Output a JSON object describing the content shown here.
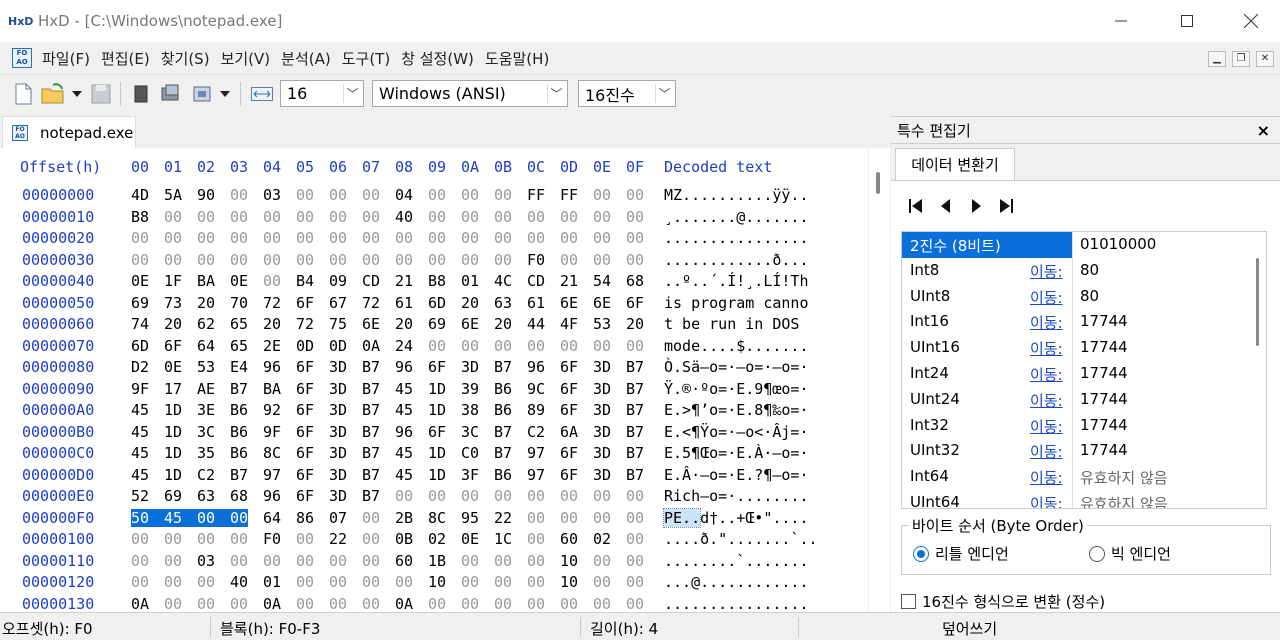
{
  "window": {
    "title": "HxD - [C:\\Windows\\notepad.exe]",
    "logo_text": "HxD",
    "minimize_icon": "minimize-icon",
    "maximize_icon": "maximize-icon",
    "close_icon": "close-icon"
  },
  "menu": {
    "items": [
      "파일(F)",
      "편집(E)",
      "찾기(S)",
      "보기(V)",
      "분석(A)",
      "도구(T)",
      "창 설정(W)",
      "도움말(H)"
    ]
  },
  "toolbar": {
    "bytes_per_row": "16",
    "charset": "Windows (ANSI)",
    "offset_base": "16진수",
    "icons": [
      "new-file-icon",
      "open-file-icon",
      "dropdown-icon",
      "save-icon",
      "copy-icon",
      "disk-icon",
      "process-icon",
      "dropdown-icon",
      "bytes-per-row-icon"
    ]
  },
  "tab": {
    "label": "notepad.exe"
  },
  "hex_view": {
    "offset_header": "Offset(h)",
    "columns": [
      "00",
      "01",
      "02",
      "03",
      "04",
      "05",
      "06",
      "07",
      "08",
      "09",
      "0A",
      "0B",
      "0C",
      "0D",
      "0E",
      "0F"
    ],
    "decoded_header": "Decoded text",
    "rows": [
      {
        "offset": "00000000",
        "bytes": [
          "4D",
          "5A",
          "90",
          "00",
          "03",
          "00",
          "00",
          "00",
          "04",
          "00",
          "00",
          "00",
          "FF",
          "FF",
          "00",
          "00"
        ],
        "text": "MZ..........ÿÿ.."
      },
      {
        "offset": "00000010",
        "bytes": [
          "B8",
          "00",
          "00",
          "00",
          "00",
          "00",
          "00",
          "00",
          "40",
          "00",
          "00",
          "00",
          "00",
          "00",
          "00",
          "00"
        ],
        "text": "¸.......@......."
      },
      {
        "offset": "00000020",
        "bytes": [
          "00",
          "00",
          "00",
          "00",
          "00",
          "00",
          "00",
          "00",
          "00",
          "00",
          "00",
          "00",
          "00",
          "00",
          "00",
          "00"
        ],
        "text": "................"
      },
      {
        "offset": "00000030",
        "bytes": [
          "00",
          "00",
          "00",
          "00",
          "00",
          "00",
          "00",
          "00",
          "00",
          "00",
          "00",
          "00",
          "F0",
          "00",
          "00",
          "00"
        ],
        "text": "............ð..."
      },
      {
        "offset": "00000040",
        "bytes": [
          "0E",
          "1F",
          "BA",
          "0E",
          "00",
          "B4",
          "09",
          "CD",
          "21",
          "B8",
          "01",
          "4C",
          "CD",
          "21",
          "54",
          "68"
        ],
        "text": "..º..´.Í!¸.LÍ!Th"
      },
      {
        "offset": "00000050",
        "bytes": [
          "69",
          "73",
          "20",
          "70",
          "72",
          "6F",
          "67",
          "72",
          "61",
          "6D",
          "20",
          "63",
          "61",
          "6E",
          "6E",
          "6F"
        ],
        "text": "is program canno"
      },
      {
        "offset": "00000060",
        "bytes": [
          "74",
          "20",
          "62",
          "65",
          "20",
          "72",
          "75",
          "6E",
          "20",
          "69",
          "6E",
          "20",
          "44",
          "4F",
          "53",
          "20"
        ],
        "text": "t be run in DOS "
      },
      {
        "offset": "00000070",
        "bytes": [
          "6D",
          "6F",
          "64",
          "65",
          "2E",
          "0D",
          "0D",
          "0A",
          "24",
          "00",
          "00",
          "00",
          "00",
          "00",
          "00",
          "00"
        ],
        "text": "mode....$......."
      },
      {
        "offset": "00000080",
        "bytes": [
          "D2",
          "0E",
          "53",
          "E4",
          "96",
          "6F",
          "3D",
          "B7",
          "96",
          "6F",
          "3D",
          "B7",
          "96",
          "6F",
          "3D",
          "B7"
        ],
        "text": "Ò.Sä–o=·–o=·–o=·"
      },
      {
        "offset": "00000090",
        "bytes": [
          "9F",
          "17",
          "AE",
          "B7",
          "BA",
          "6F",
          "3D",
          "B7",
          "45",
          "1D",
          "39",
          "B6",
          "9C",
          "6F",
          "3D",
          "B7"
        ],
        "text": "Ÿ.®·ºo=·E.9¶œo=·"
      },
      {
        "offset": "000000A0",
        "bytes": [
          "45",
          "1D",
          "3E",
          "B6",
          "92",
          "6F",
          "3D",
          "B7",
          "45",
          "1D",
          "38",
          "B6",
          "89",
          "6F",
          "3D",
          "B7"
        ],
        "text": "E.>¶’o=·E.8¶‰o=·"
      },
      {
        "offset": "000000B0",
        "bytes": [
          "45",
          "1D",
          "3C",
          "B6",
          "9F",
          "6F",
          "3D",
          "B7",
          "96",
          "6F",
          "3C",
          "B7",
          "C2",
          "6A",
          "3D",
          "B7"
        ],
        "text": "E.<¶Ÿo=·–o<·Âj=·"
      },
      {
        "offset": "000000C0",
        "bytes": [
          "45",
          "1D",
          "35",
          "B6",
          "8C",
          "6F",
          "3D",
          "B7",
          "45",
          "1D",
          "C0",
          "B7",
          "97",
          "6F",
          "3D",
          "B7"
        ],
        "text": "E.5¶Œo=·E.À·—o=·"
      },
      {
        "offset": "000000D0",
        "bytes": [
          "45",
          "1D",
          "C2",
          "B7",
          "97",
          "6F",
          "3D",
          "B7",
          "45",
          "1D",
          "3F",
          "B6",
          "97",
          "6F",
          "3D",
          "B7"
        ],
        "text": "E.Â·—o=·E.?¶—o=·"
      },
      {
        "offset": "000000E0",
        "bytes": [
          "52",
          "69",
          "63",
          "68",
          "96",
          "6F",
          "3D",
          "B7",
          "00",
          "00",
          "00",
          "00",
          "00",
          "00",
          "00",
          "00"
        ],
        "text": "Rich–o=·........"
      },
      {
        "offset": "000000F0",
        "bytes": [
          "50",
          "45",
          "00",
          "00",
          "64",
          "86",
          "07",
          "00",
          "2B",
          "8C",
          "95",
          "22",
          "00",
          "00",
          "00",
          "00"
        ],
        "text": "PE..d†..+Œ•\"...."
      },
      {
        "offset": "00000100",
        "bytes": [
          "00",
          "00",
          "00",
          "00",
          "F0",
          "00",
          "22",
          "00",
          "0B",
          "02",
          "0E",
          "1C",
          "00",
          "60",
          "02",
          "00"
        ],
        "text": "....ð.\".......`.."
      },
      {
        "offset": "00000110",
        "bytes": [
          "00",
          "00",
          "03",
          "00",
          "00",
          "00",
          "00",
          "00",
          "60",
          "1B",
          "00",
          "00",
          "00",
          "10",
          "00",
          "00"
        ],
        "text": "........`......."
      },
      {
        "offset": "00000120",
        "bytes": [
          "00",
          "00",
          "00",
          "40",
          "01",
          "00",
          "00",
          "00",
          "00",
          "10",
          "00",
          "00",
          "00",
          "10",
          "00",
          "00"
        ],
        "text": "...@............"
      },
      {
        "offset": "00000130",
        "bytes": [
          "0A",
          "00",
          "00",
          "00",
          "0A",
          "00",
          "00",
          "00",
          "0A",
          "00",
          "00",
          "00",
          "00",
          "00",
          "00",
          "00"
        ],
        "text": "................"
      }
    ],
    "selected_row": 15,
    "selected_bytes": [
      0,
      1,
      2,
      3
    ]
  },
  "panel": {
    "title": "특수 편집기",
    "close_label": "×",
    "tab_label": "데이터 변환기",
    "nav_icons": [
      "first-icon",
      "prev-icon",
      "next-icon",
      "last-icon"
    ],
    "rows": [
      {
        "name": "2진수 (8비트)",
        "link": "",
        "value": "01010000",
        "highlight": true
      },
      {
        "name": "Int8",
        "link": "이동:",
        "value": "80"
      },
      {
        "name": "UInt8",
        "link": "이동:",
        "value": "80"
      },
      {
        "name": "Int16",
        "link": "이동:",
        "value": "17744"
      },
      {
        "name": "UInt16",
        "link": "이동:",
        "value": "17744"
      },
      {
        "name": "Int24",
        "link": "이동:",
        "value": "17744"
      },
      {
        "name": "UInt24",
        "link": "이동:",
        "value": "17744"
      },
      {
        "name": "Int32",
        "link": "이동:",
        "value": "17744"
      },
      {
        "name": "UInt32",
        "link": "이동:",
        "value": "17744"
      },
      {
        "name": "Int64",
        "link": "이동:",
        "value": "유효하지 않음",
        "na": true
      },
      {
        "name": "UInt64",
        "link": "이동:",
        "value": "유효하지 않음",
        "na": true
      }
    ],
    "byte_order_legend": "바이트 순서 (Byte Order)",
    "little_endian": "리틀 엔디언",
    "big_endian": "빅 엔디언",
    "little_selected": true,
    "hex_checkbox": "16진수 형식으로 변환 (정수)"
  },
  "status": {
    "offset": "오프셋(h): F0",
    "block": "블록(h): F0-F3",
    "length": "길이(h): 4",
    "mode": "덮어쓰기"
  },
  "colors": {
    "selection": "#0a6fd8",
    "offset_text": "#1e3ec8",
    "zero_byte": "#9a9a9a",
    "link": "#1c48c4"
  }
}
